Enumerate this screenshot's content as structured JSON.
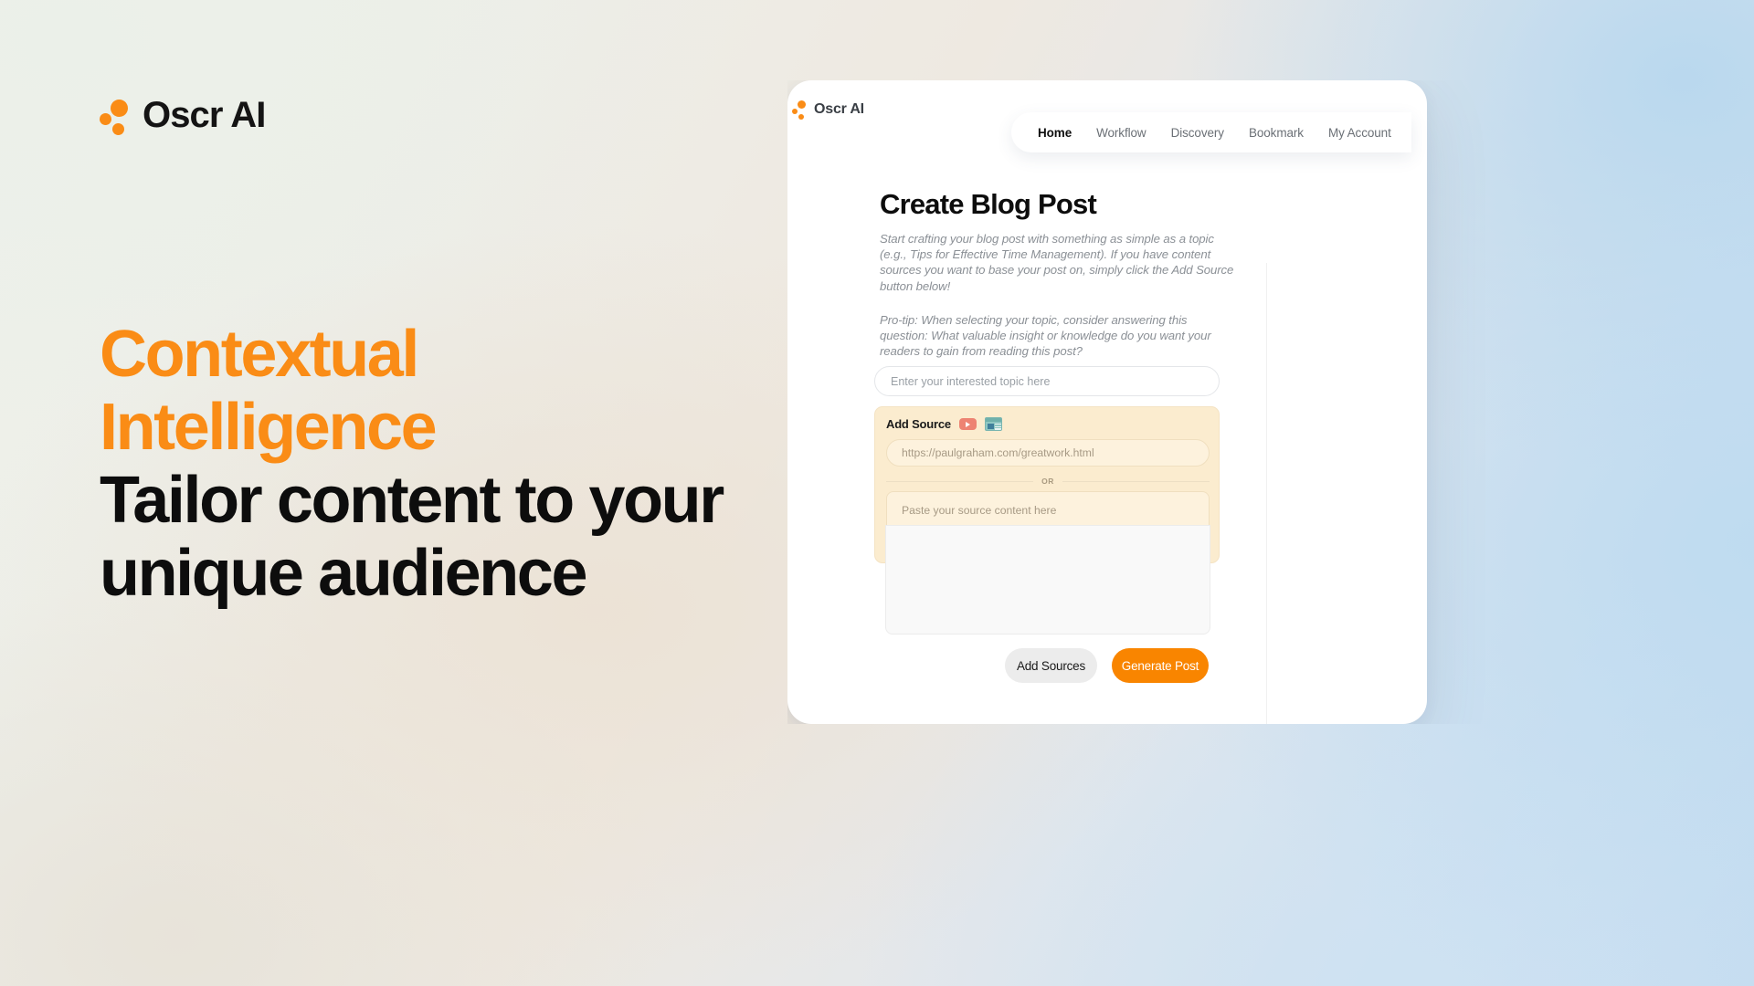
{
  "brand": {
    "name": "Oscr AI",
    "logo_icon": "three-dots-logo-icon",
    "accent_color": "#FA8C16"
  },
  "hero": {
    "headline_accent_line1": "Contextual",
    "headline_accent_line2": "Intelligence",
    "headline_dark_line1": "Tailor content to your",
    "headline_dark_line2": "unique audience",
    "accent_color": "#FA8C16",
    "dark_color": "#0d0d0d"
  },
  "app": {
    "brand_name": "Oscr AI",
    "nav": {
      "items": [
        {
          "label": "Home",
          "active": true
        },
        {
          "label": "Workflow",
          "active": false
        },
        {
          "label": "Discovery",
          "active": false
        },
        {
          "label": "Bookmark",
          "active": false
        },
        {
          "label": "My Account",
          "active": false
        }
      ]
    },
    "page": {
      "title": "Create Blog Post",
      "description_1": "Start crafting your blog post with something as simple as a topic (e.g., Tips for Effective Time Management). If you have content sources you want to base your post on, simply click the Add Source button below!",
      "description_2": "Pro-tip: When selecting your topic, consider answering this question: What valuable insight or knowledge do you want your readers to gain from reading this post?"
    },
    "topic_input": {
      "placeholder": "Enter your interested topic here",
      "value": ""
    },
    "add_source": {
      "title": "Add Source",
      "icons": [
        {
          "name": "youtube-icon",
          "color": "#ED8372"
        },
        {
          "name": "webpage-icon",
          "color": "#8fc7c2"
        }
      ],
      "url_input": {
        "placeholder": "https://paulgraham.com/greatwork.html",
        "value": ""
      },
      "divider_label": "OR",
      "paste_area": {
        "placeholder": "Paste your source content here",
        "value": ""
      },
      "panel_color": "#fbeccf"
    },
    "actions": {
      "secondary_label": "Add Sources",
      "primary_label": "Generate Post",
      "primary_color": "#F98500",
      "secondary_color": "#ececec"
    }
  }
}
